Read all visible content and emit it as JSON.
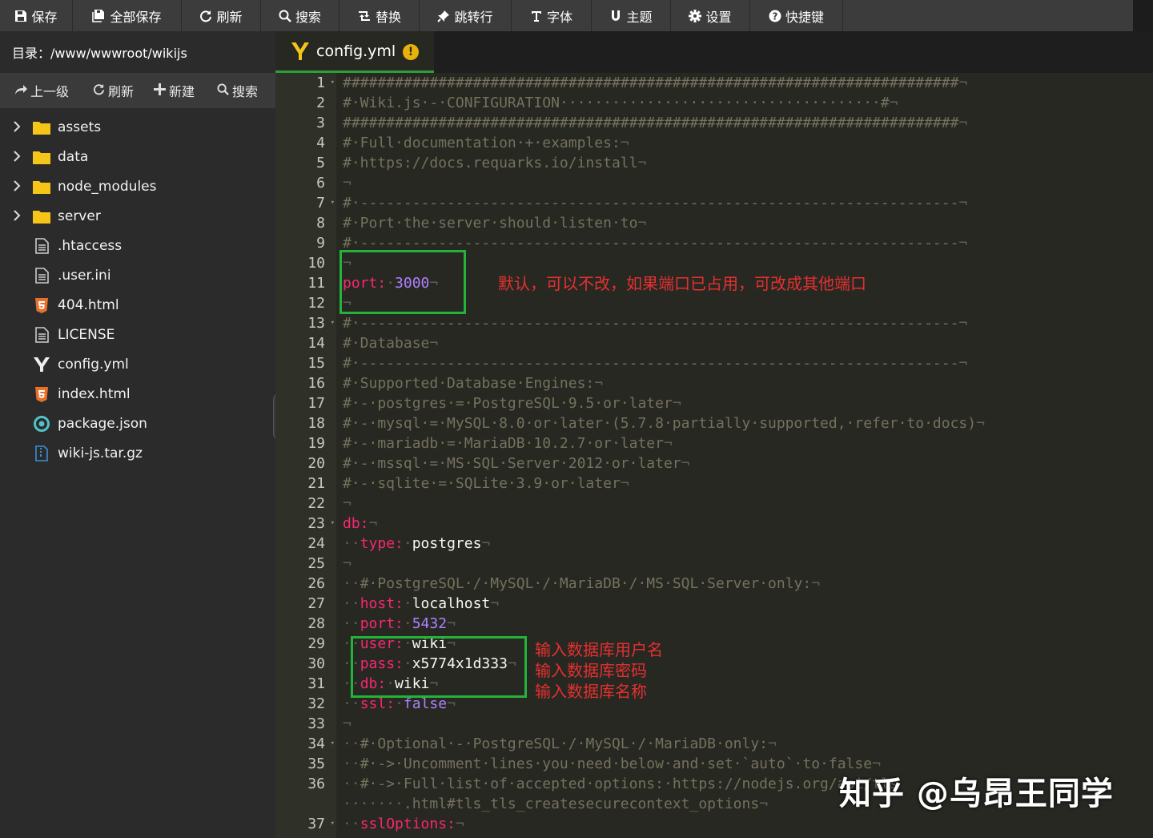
{
  "toolbar": {
    "buttons": [
      {
        "label": "保存",
        "icon": "save-icon"
      },
      {
        "label": "全部保存",
        "icon": "save-all-icon"
      },
      {
        "label": "刷新",
        "icon": "refresh-icon"
      },
      {
        "label": "搜索",
        "icon": "search-icon"
      },
      {
        "label": "替换",
        "icon": "replace-icon"
      },
      {
        "label": "跳转行",
        "icon": "pin-icon"
      },
      {
        "label": "字体",
        "icon": "text-icon"
      },
      {
        "label": "主题",
        "icon": "theme-icon"
      },
      {
        "label": "设置",
        "icon": "gear-icon"
      },
      {
        "label": "快捷键",
        "icon": "help-icon"
      }
    ]
  },
  "sidebar": {
    "dir_label": "目录：/www/wwwroot/wikijs",
    "tools": {
      "up": "上一级",
      "refresh": "刷新",
      "new": "新建",
      "search": "搜索"
    },
    "items": [
      {
        "name": "assets",
        "type": "folder"
      },
      {
        "name": "data",
        "type": "folder"
      },
      {
        "name": "node_modules",
        "type": "folder"
      },
      {
        "name": "server",
        "type": "folder"
      },
      {
        "name": ".htaccess",
        "type": "file"
      },
      {
        "name": ".user.ini",
        "type": "file"
      },
      {
        "name": "404.html",
        "type": "html"
      },
      {
        "name": "LICENSE",
        "type": "file"
      },
      {
        "name": "config.yml",
        "type": "yaml"
      },
      {
        "name": "index.html",
        "type": "html"
      },
      {
        "name": "package.json",
        "type": "json"
      },
      {
        "name": "wiki-js.tar.gz",
        "type": "archive"
      }
    ]
  },
  "tab": {
    "name": "config.yml",
    "warning": "!"
  },
  "editor": {
    "lines": [
      {
        "n": "1",
        "fold": true
      },
      {
        "n": "2"
      },
      {
        "n": "3"
      },
      {
        "n": "4"
      },
      {
        "n": "5"
      },
      {
        "n": "6"
      },
      {
        "n": "7",
        "fold": true
      },
      {
        "n": "8"
      },
      {
        "n": "9"
      },
      {
        "n": "10"
      },
      {
        "n": "11"
      },
      {
        "n": "12"
      },
      {
        "n": "13",
        "fold": true
      },
      {
        "n": "14"
      },
      {
        "n": "15"
      },
      {
        "n": "16"
      },
      {
        "n": "17"
      },
      {
        "n": "18"
      },
      {
        "n": "19"
      },
      {
        "n": "20"
      },
      {
        "n": "21"
      },
      {
        "n": "22"
      },
      {
        "n": "23",
        "fold": true
      },
      {
        "n": "24"
      },
      {
        "n": "25"
      },
      {
        "n": "26"
      },
      {
        "n": "27"
      },
      {
        "n": "28"
      },
      {
        "n": "29"
      },
      {
        "n": "30"
      },
      {
        "n": "31"
      },
      {
        "n": "32"
      },
      {
        "n": "33"
      },
      {
        "n": "34",
        "fold": true
      },
      {
        "n": "35"
      },
      {
        "n": "36"
      },
      {
        "n": ""
      },
      {
        "n": "37",
        "fold": true
      }
    ],
    "code": [
      [
        {
          "t": "#######################################################################",
          "c": "c"
        },
        {
          "t": "¬",
          "c": "g"
        }
      ],
      [
        {
          "t": "#·Wiki.js·-·CONFIGURATION·····································#",
          "c": "c"
        },
        {
          "t": "¬",
          "c": "g"
        }
      ],
      [
        {
          "t": "#######################################################################",
          "c": "c"
        },
        {
          "t": "¬",
          "c": "g"
        }
      ],
      [
        {
          "t": "#·Full·documentation·+·examples:",
          "c": "c"
        },
        {
          "t": "¬",
          "c": "g"
        }
      ],
      [
        {
          "t": "#·https://docs.requarks.io/install",
          "c": "c"
        },
        {
          "t": "¬",
          "c": "g"
        }
      ],
      [
        {
          "t": "¬",
          "c": "g"
        }
      ],
      [
        {
          "t": "#·---------------------------------------------------------------------",
          "c": "c"
        },
        {
          "t": "¬",
          "c": "g"
        }
      ],
      [
        {
          "t": "#·Port·the·server·should·listen·to",
          "c": "c"
        },
        {
          "t": "¬",
          "c": "g"
        }
      ],
      [
        {
          "t": "#·---------------------------------------------------------------------",
          "c": "c"
        },
        {
          "t": "¬",
          "c": "g"
        }
      ],
      [
        {
          "t": "¬",
          "c": "g"
        }
      ],
      [
        {
          "t": "port:",
          "c": "k"
        },
        {
          "t": "·",
          "c": "g"
        },
        {
          "t": "3000",
          "c": "n"
        },
        {
          "t": "¬",
          "c": "g"
        }
      ],
      [
        {
          "t": "¬",
          "c": "g"
        }
      ],
      [
        {
          "t": "#·---------------------------------------------------------------------",
          "c": "c"
        },
        {
          "t": "¬",
          "c": "g"
        }
      ],
      [
        {
          "t": "#·Database",
          "c": "c"
        },
        {
          "t": "¬",
          "c": "g"
        }
      ],
      [
        {
          "t": "#·---------------------------------------------------------------------",
          "c": "c"
        },
        {
          "t": "¬",
          "c": "g"
        }
      ],
      [
        {
          "t": "#·Supported·Database·Engines:",
          "c": "c"
        },
        {
          "t": "¬",
          "c": "g"
        }
      ],
      [
        {
          "t": "#·-·postgres·=·PostgreSQL·9.5·or·later",
          "c": "c"
        },
        {
          "t": "¬",
          "c": "g"
        }
      ],
      [
        {
          "t": "#·-·mysql·=·MySQL·8.0·or·later·(5.7.8·partially·supported,·refer·to·docs)",
          "c": "c"
        },
        {
          "t": "¬",
          "c": "g"
        }
      ],
      [
        {
          "t": "#·-·mariadb·=·MariaDB·10.2.7·or·later",
          "c": "c"
        },
        {
          "t": "¬",
          "c": "g"
        }
      ],
      [
        {
          "t": "#·-·mssql·=·MS·SQL·Server·2012·or·later",
          "c": "c"
        },
        {
          "t": "¬",
          "c": "g"
        }
      ],
      [
        {
          "t": "#·-·sqlite·=·SQLite·3.9·or·later",
          "c": "c"
        },
        {
          "t": "¬",
          "c": "g"
        }
      ],
      [
        {
          "t": "¬",
          "c": "g"
        }
      ],
      [
        {
          "t": "db:",
          "c": "k"
        },
        {
          "t": "¬",
          "c": "g"
        }
      ],
      [
        {
          "t": "··",
          "c": "g"
        },
        {
          "t": "type:",
          "c": "k"
        },
        {
          "t": "·",
          "c": "g"
        },
        {
          "t": "postgres",
          "c": "s"
        },
        {
          "t": "¬",
          "c": "g"
        }
      ],
      [
        {
          "t": "¬",
          "c": "g"
        }
      ],
      [
        {
          "t": "··",
          "c": "g"
        },
        {
          "t": "#·PostgreSQL·/·MySQL·/·MariaDB·/·MS·SQL·Server·only:",
          "c": "c"
        },
        {
          "t": "¬",
          "c": "g"
        }
      ],
      [
        {
          "t": "··",
          "c": "g"
        },
        {
          "t": "host:",
          "c": "k"
        },
        {
          "t": "·",
          "c": "g"
        },
        {
          "t": "localhost",
          "c": "s"
        },
        {
          "t": "¬",
          "c": "g"
        }
      ],
      [
        {
          "t": "··",
          "c": "g"
        },
        {
          "t": "port:",
          "c": "k"
        },
        {
          "t": "·",
          "c": "g"
        },
        {
          "t": "5432",
          "c": "n"
        },
        {
          "t": "¬",
          "c": "g"
        }
      ],
      [
        {
          "t": "··",
          "c": "g"
        },
        {
          "t": "user:",
          "c": "k"
        },
        {
          "t": "·",
          "c": "g"
        },
        {
          "t": "wiki",
          "c": "s"
        },
        {
          "t": "¬",
          "c": "g"
        }
      ],
      [
        {
          "t": "··",
          "c": "g"
        },
        {
          "t": "pass:",
          "c": "k"
        },
        {
          "t": "·",
          "c": "g"
        },
        {
          "t": "x5774x1d333",
          "c": "s"
        },
        {
          "t": "¬",
          "c": "g"
        }
      ],
      [
        {
          "t": "··",
          "c": "g"
        },
        {
          "t": "db:",
          "c": "k"
        },
        {
          "t": "·",
          "c": "g"
        },
        {
          "t": "wiki",
          "c": "s"
        },
        {
          "t": "¬",
          "c": "g"
        }
      ],
      [
        {
          "t": "··",
          "c": "g"
        },
        {
          "t": "ssl:",
          "c": "k"
        },
        {
          "t": "·",
          "c": "g"
        },
        {
          "t": "false",
          "c": "n"
        },
        {
          "t": "¬",
          "c": "g"
        }
      ],
      [
        {
          "t": "¬",
          "c": "g"
        }
      ],
      [
        {
          "t": "··",
          "c": "g"
        },
        {
          "t": "#·Optional·-·PostgreSQL·/·MySQL·/·MariaDB·only:",
          "c": "c"
        },
        {
          "t": "¬",
          "c": "g"
        }
      ],
      [
        {
          "t": "··",
          "c": "g"
        },
        {
          "t": "#·->·Uncomment·lines·you·need·below·and·set·`auto`·to·false",
          "c": "c"
        },
        {
          "t": "¬",
          "c": "g"
        }
      ],
      [
        {
          "t": "··",
          "c": "g"
        },
        {
          "t": "#·->·Full·list·of·accepted·options:·https://nodejs.org/api/tls",
          "c": "c"
        }
      ],
      [
        {
          "t": "·······",
          "c": "g"
        },
        {
          "t": ".html#tls_tls_createsecurecontext_options",
          "c": "c"
        },
        {
          "t": "¬",
          "c": "g"
        }
      ],
      [
        {
          "t": "··",
          "c": "g"
        },
        {
          "t": "sslOptions:",
          "c": "k"
        },
        {
          "t": "¬",
          "c": "g"
        }
      ]
    ]
  },
  "annotations": {
    "port_note": "默认，可以不改，如果端口已占用，可改成其他端口",
    "user_note": "输入数据库用户名",
    "pass_note": "输入数据库密码",
    "db_note": "输入数据库名称"
  },
  "watermark": "知乎 @乌昂王同学",
  "colors": {
    "editor_bg": "#272822",
    "keyword": "#f92672",
    "number": "#ae81ff",
    "comment": "#75715e",
    "highlight_box": "#25b23a",
    "annotation": "#e63030"
  }
}
